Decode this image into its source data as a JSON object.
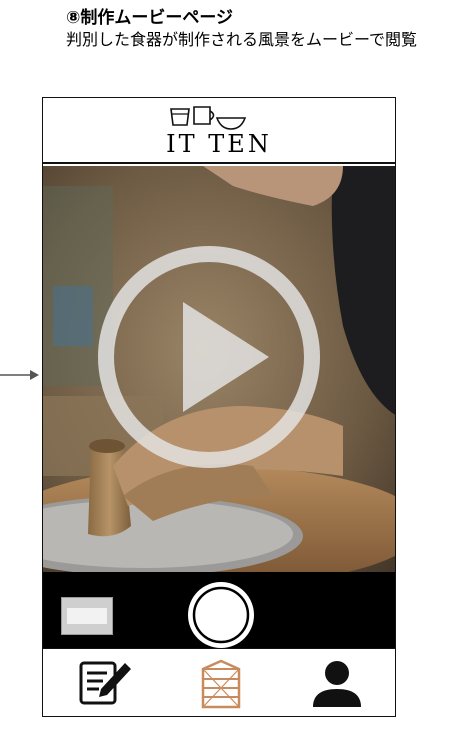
{
  "caption": {
    "title": "⑧制作ムービーページ",
    "description": "判別した食器が制作される風景をムービーで閲覧"
  },
  "header": {
    "logo_text": "IT TEN"
  },
  "video": {
    "play_icon": "play-circle-icon",
    "scene": "pottery-wheel-throwing"
  },
  "toolbar": {
    "thumbnail_icon": "scanned-image-thumbnail",
    "shutter_icon": "shutter-button-circle"
  },
  "tabbar": {
    "tabs": [
      {
        "icon": "edit-note-icon",
        "color": "#111111"
      },
      {
        "icon": "shelf-icon",
        "color": "#c98a5e",
        "active": true
      },
      {
        "icon": "user-icon",
        "color": "#111111"
      }
    ]
  },
  "colors": {
    "accent": "#c98a5e",
    "toolbar": "#000000"
  }
}
